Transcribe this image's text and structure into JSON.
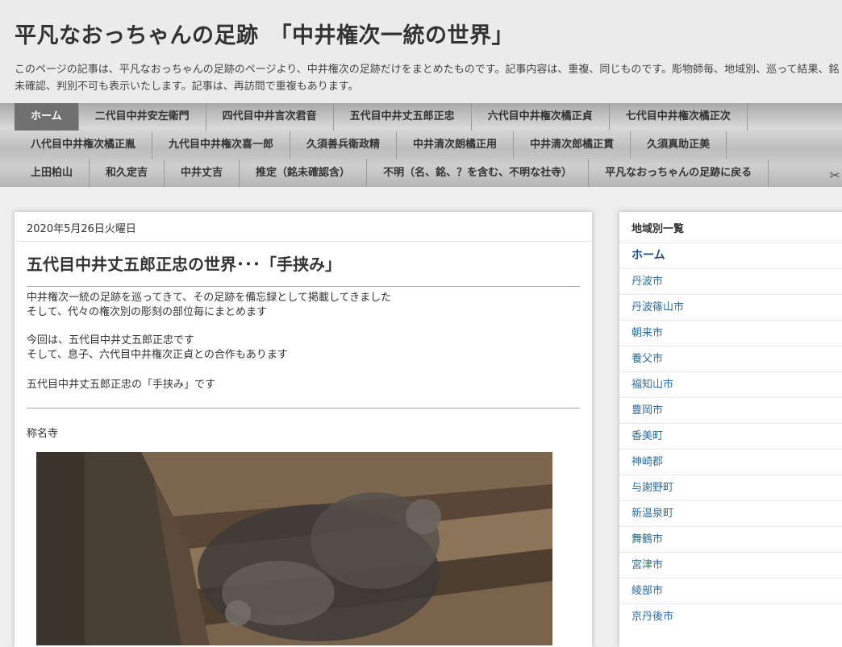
{
  "header": {
    "title": "平凡なおっちゃんの足跡　「中井権次一統の世界」",
    "description": "このページの記事は、平凡なおっちゃんの足跡のページより、中井権次の足跡だけをまとめたものです。記事内容は、重複、同じものです。彫物師毎、地域別、巡って結果、銘未確認、判別不可も表示いたします。記事は、再訪問で重複もあります。"
  },
  "tabs": {
    "row1": [
      "ホーム",
      "二代目中井安左衛門",
      "四代目中井言次君音",
      "五代目中井丈五郎正忠",
      "六代目中井権次橘正貞",
      "七代目中井権次橘正次"
    ],
    "row2": [
      "八代目中井権次橘正胤",
      "九代目中井権次喜一郎",
      "久須善兵衛政精",
      "中井清次朗橘正用",
      "中井清次郎橘正貫",
      "久須真助正美"
    ],
    "row3": [
      "上田柏山",
      "和久定吉",
      "中井丈吉",
      "推定（銘未確認含）",
      "不明（名、銘、？を含む、不明な社寺）",
      "平凡なおっちゃんの足跡に戻る"
    ]
  },
  "post": {
    "date": "2020年5月26日火曜日",
    "title": "五代目中井丈五郎正忠の世界･･･「手挟み」",
    "para1": [
      "中井権次一統の足跡を巡ってきて、その足跡を備忘録として掲載してきました",
      "そして、代々の権次別の彫刻の部位毎にまとめます"
    ],
    "para2": [
      "今回は、五代目中井丈五郎正忠です",
      "そして、息子、六代目中井権次正貞との合作もあります"
    ],
    "para3": "五代目中井丈五郎正忠の「手挟み」です",
    "para4": "称名寺"
  },
  "sidebar": {
    "title": "地域別一覧",
    "items": [
      "ホーム",
      "丹波市",
      "丹波篠山市",
      "朝来市",
      "養父市",
      "福知山市",
      "豊岡市",
      "香美町",
      "神崎郡",
      "与謝野町",
      "新温泉町",
      "舞鶴市",
      "宮津市",
      "綾部市",
      "京丹後市"
    ]
  },
  "icons": {
    "tools": "wrench-screwdriver-icon"
  }
}
